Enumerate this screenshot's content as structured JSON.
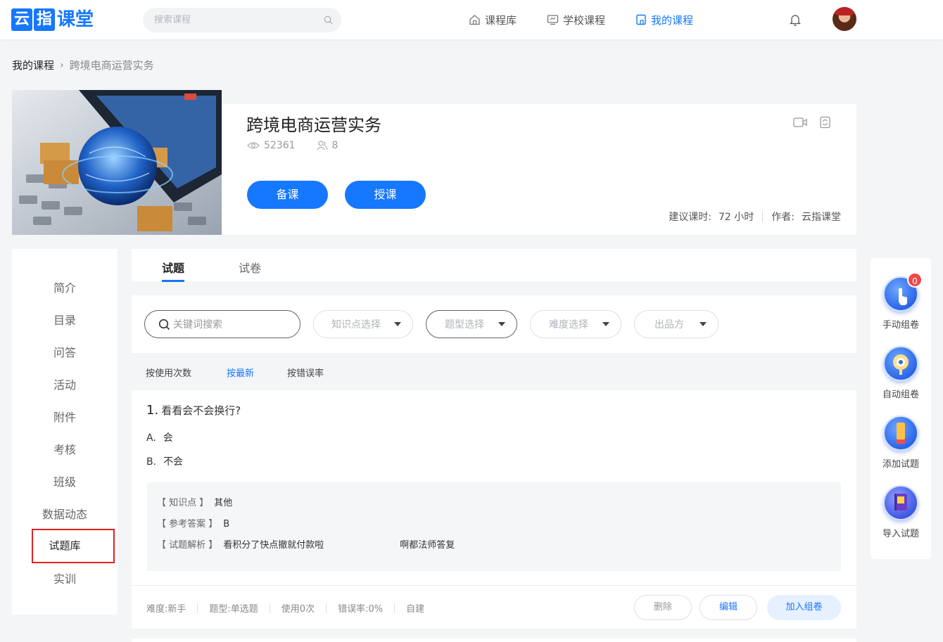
{
  "header": {
    "logo": {
      "part1": "云",
      "part2": "指",
      "part3": "课堂"
    },
    "search_placeholder": "搜索课程",
    "nav": [
      {
        "label": "课程库",
        "icon": "home-icon",
        "active": false
      },
      {
        "label": "学校课程",
        "icon": "monitor-icon",
        "active": false
      },
      {
        "label": "我的课程",
        "icon": "bookmark-icon",
        "active": true
      }
    ]
  },
  "breadcrumb": {
    "root": "我的课程",
    "current": "跨境电商运营实务"
  },
  "course": {
    "title": "跨境电商运营实务",
    "views": "52361",
    "members": "8",
    "prepare_label": "备课",
    "teach_label": "授课",
    "hours_label": "建议课时:",
    "hours_value": "72 小时",
    "author_label": "作者:",
    "author_value": "云指课堂"
  },
  "sidebar": {
    "items": [
      "简介",
      "目录",
      "问答",
      "活动",
      "附件",
      "考核",
      "班级",
      "数据动态",
      "试题库",
      "实训"
    ],
    "active": "试题库"
  },
  "tabs": [
    {
      "label": "试题",
      "active": true
    },
    {
      "label": "试卷",
      "active": false
    }
  ],
  "filters": {
    "keyword_placeholder": "关键词搜索",
    "knowledge": "知识点选择",
    "type": "题型选择",
    "difficulty": "难度选择",
    "publisher": "出品方"
  },
  "sort": [
    {
      "label": "按使用次数",
      "active": false
    },
    {
      "label": "按最新",
      "active": true
    },
    {
      "label": "按错误率",
      "active": false
    }
  ],
  "question": {
    "number": "1.",
    "text": "看看会不会换行?",
    "options": [
      {
        "key": "A.",
        "text": "会"
      },
      {
        "key": "B.",
        "text": "不会"
      }
    ],
    "knowledge_label": "【 知识点 】",
    "knowledge_value": "其他",
    "answer_label": "【 参考答案 】",
    "answer_value": "B",
    "analysis_label": "【 试题解析 】",
    "analysis_value": "看积分了快点撤就付款啦",
    "analysis_value2": "啊都法师答复",
    "difficulty": "难度:新手",
    "qtype": "题型:单选题",
    "usage": "使用0次",
    "error_rate": "错误率:0%",
    "source": "自建",
    "delete_label": "删除",
    "edit_label": "编辑",
    "add_label": "加入组卷"
  },
  "right_panel": {
    "items": [
      {
        "label": "手动组卷",
        "icon": "hand-pointer-icon",
        "badge": "0"
      },
      {
        "label": "自动组卷",
        "icon": "eye-icon"
      },
      {
        "label": "添加试题",
        "icon": "pencil-icon"
      },
      {
        "label": "导入试题",
        "icon": "book-icon"
      }
    ]
  },
  "colors": {
    "primary": "#1677ff",
    "highlight_box": "#e02020",
    "badge": "#f04848"
  }
}
